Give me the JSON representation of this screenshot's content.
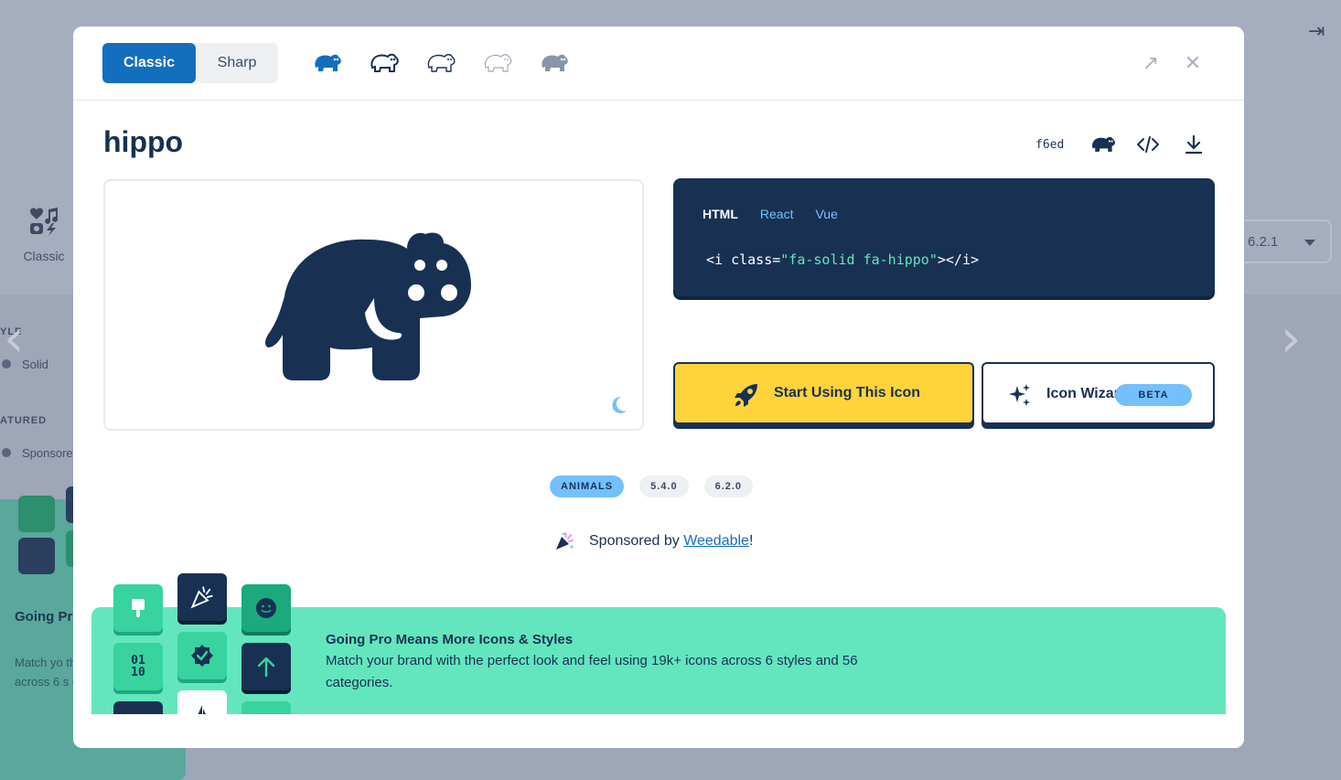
{
  "background": {
    "style_label": "Classic",
    "style_heading": "YLE",
    "style_solid": "Solid",
    "featured_heading": "ATURED",
    "featured_sponsored": "Sponsore",
    "version": "6.2.1",
    "promo_title": "Going Pr More Ico",
    "promo_desc": "Match yo the perfe feel using across 6 s categorie"
  },
  "modal": {
    "family_toggle": [
      "Classic",
      "Sharp"
    ],
    "active_family": "Classic",
    "style_icons": [
      "hippo-solid-icon",
      "hippo-regular-icon",
      "hippo-light-icon",
      "hippo-thin-icon",
      "hippo-duotone-icon"
    ],
    "icon_name": "hippo",
    "unicode": "f6ed",
    "code_tabs": [
      "HTML",
      "React",
      "Vue"
    ],
    "active_code_tab": "HTML",
    "code": {
      "prefix": "<i class=",
      "value": "\"fa-solid fa-hippo\"",
      "suffix": "></i>"
    },
    "start_button": "Start Using This Icon",
    "wizard_button": "Icon Wizard",
    "wizard_badge": "BETA",
    "tags": [
      "ANIMALS",
      "5.4.0",
      "6.2.0"
    ],
    "sponsor_prefix": "Sponsored by ",
    "sponsor_link": "Weedable",
    "sponsor_suffix": "!",
    "pro_title": "Going Pro Means More Icons & Styles",
    "pro_desc": "Match your brand with the perfect look and feel using 19k+ icons across 6 styles and 56 categories.",
    "pro_tiles": {
      "binary": "01\n10"
    }
  },
  "colors": {
    "primary": "#146ebe",
    "navy": "#183153",
    "yellow": "#ffd43b",
    "mint": "#63e6be",
    "sky": "#74c0fc"
  }
}
